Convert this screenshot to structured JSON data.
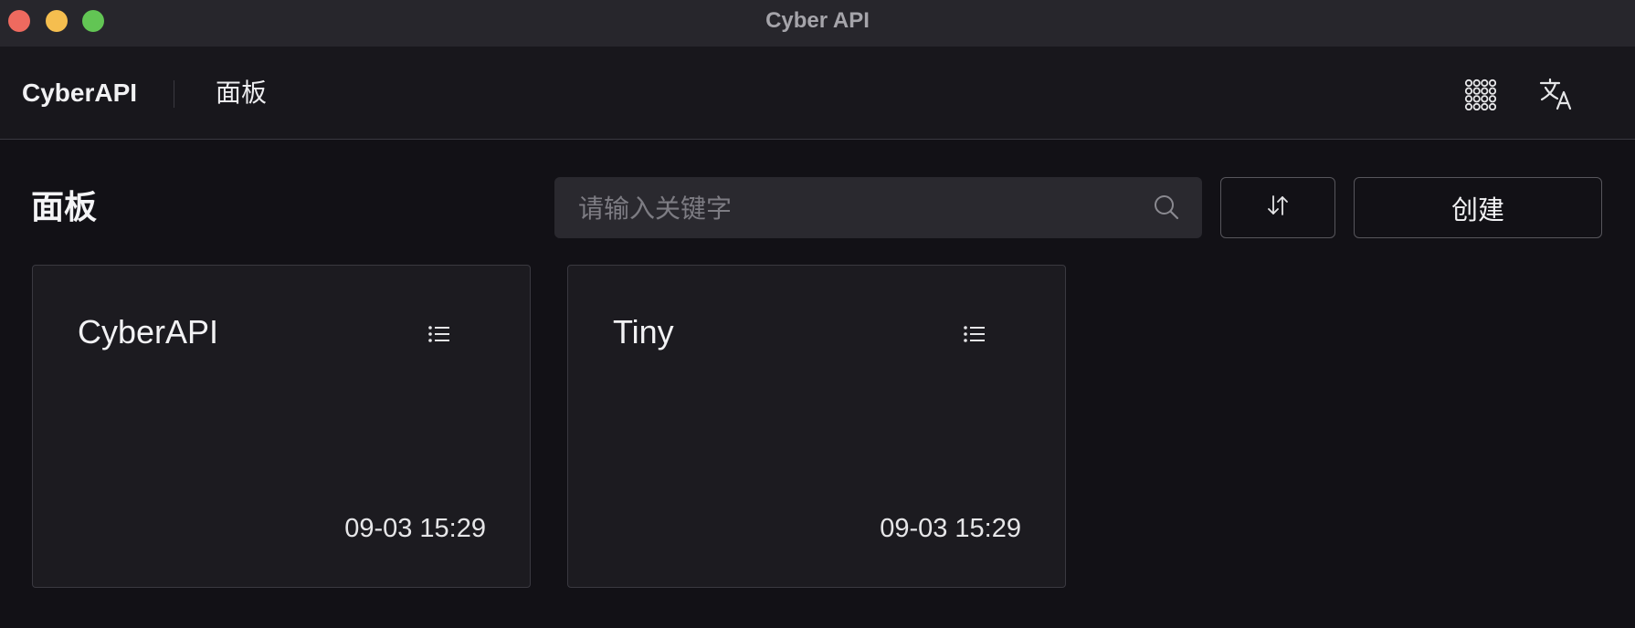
{
  "window": {
    "title": "Cyber API"
  },
  "nav": {
    "brand": "CyberAPI",
    "items": [
      {
        "label": "面板"
      }
    ],
    "right_icons": [
      "apps-grid-icon",
      "translate-icon"
    ]
  },
  "main": {
    "page_title": "面板",
    "search": {
      "placeholder": "请输入关键字",
      "value": ""
    },
    "sort_icon": "sort-icon",
    "create_label": "创建"
  },
  "cards": [
    {
      "title": "CyberAPI",
      "time": "09-03 15:29",
      "icon": "list-menu-icon"
    },
    {
      "title": "Tiny",
      "time": "09-03 15:29",
      "icon": "list-menu-icon"
    }
  ],
  "colors": {
    "background": "#121116",
    "titlebar": "#27262c",
    "navbar": "#18171c",
    "card": "#1c1b20",
    "border": "#3a3940",
    "close": "#ee6a5f",
    "minimize": "#f5be4f",
    "maximize": "#62c554"
  }
}
